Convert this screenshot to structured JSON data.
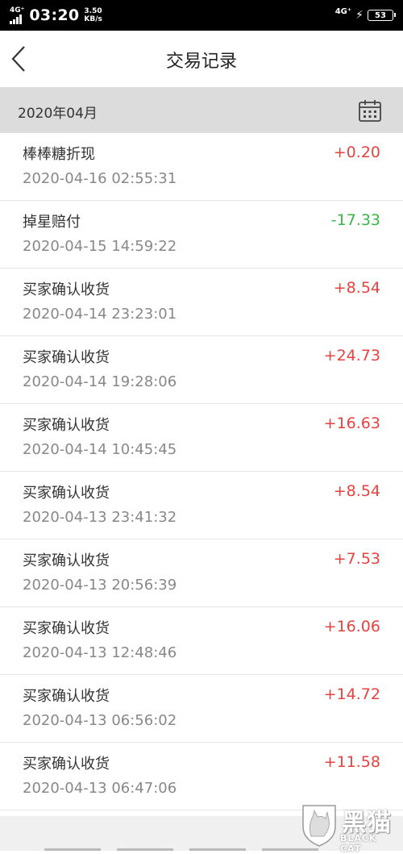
{
  "status_bar": {
    "network_left": "4G⁺",
    "time": "03:20",
    "speed_value": "3.50",
    "speed_unit": "KB/s",
    "network_right": "4G⁺",
    "battery": "53"
  },
  "header": {
    "title": "交易记录",
    "back_icon": "chevron-left-icon"
  },
  "month_bar": {
    "label": "2020年04月",
    "calendar_icon": "calendar-icon"
  },
  "colors": {
    "positive": "#e64340",
    "negative": "#3bb54a",
    "month_bar_bg": "#dcdcdc"
  },
  "transactions": [
    {
      "name": "棒棒糖折现",
      "datetime": "2020-04-16 02:55:31",
      "amount": "+0.20",
      "sign": "pos"
    },
    {
      "name": "掉星赔付",
      "datetime": "2020-04-15 14:59:22",
      "amount": "-17.33",
      "sign": "neg"
    },
    {
      "name": "买家确认收货",
      "datetime": "2020-04-14 23:23:01",
      "amount": "+8.54",
      "sign": "pos"
    },
    {
      "name": "买家确认收货",
      "datetime": "2020-04-14 19:28:06",
      "amount": "+24.73",
      "sign": "pos"
    },
    {
      "name": "买家确认收货",
      "datetime": "2020-04-14 10:45:45",
      "amount": "+16.63",
      "sign": "pos"
    },
    {
      "name": "买家确认收货",
      "datetime": "2020-04-13 23:41:32",
      "amount": "+8.54",
      "sign": "pos"
    },
    {
      "name": "买家确认收货",
      "datetime": "2020-04-13 20:56:39",
      "amount": "+7.53",
      "sign": "pos"
    },
    {
      "name": "买家确认收货",
      "datetime": "2020-04-13 12:48:46",
      "amount": "+16.06",
      "sign": "pos"
    },
    {
      "name": "买家确认收货",
      "datetime": "2020-04-13 06:56:02",
      "amount": "+14.72",
      "sign": "pos"
    },
    {
      "name": "买家确认收货",
      "datetime": "2020-04-13 06:47:06",
      "amount": "+11.58",
      "sign": "pos"
    }
  ],
  "watermark": {
    "text_cn": "黑猫",
    "text_en": "BLACK CAT"
  }
}
